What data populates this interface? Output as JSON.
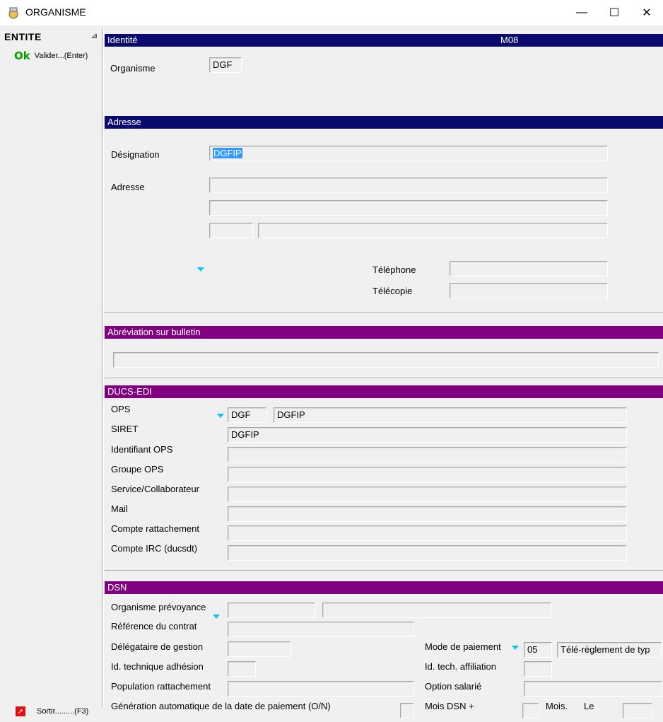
{
  "window": {
    "title": "ORGANISME",
    "minimize": "—",
    "maximize": "☐",
    "close": "✕"
  },
  "sidebar": {
    "entite": "ENTITE",
    "ok_icon": "Ok",
    "ok_label": "Valider...(Enter)",
    "sortir_label": "Sortir.........(F3)"
  },
  "identite": {
    "header": "Identité",
    "code": "M08",
    "organisme_label": "Organisme",
    "organisme_value": "DGF"
  },
  "adresse": {
    "header": "Adresse",
    "designation_label": "Désignation",
    "designation_value": "DGFIP",
    "adresse_label": "Adresse",
    "telephone_label": "Téléphone",
    "telecopie_label": "Télécopie"
  },
  "abreviation": {
    "header": "Abréviation sur bulletin"
  },
  "ducs": {
    "header": "DUCS-EDI",
    "ops_label": "OPS",
    "ops_code": "DGF",
    "ops_name": "DGFIP",
    "siret_label": "SIRET",
    "siret_value": "DGFIP",
    "identifiant_label": "Identifiant OPS",
    "groupe_label": "Groupe OPS",
    "service_label": "Service/Collaborateur",
    "mail_label": "Mail",
    "compte_label": "Compte rattachement",
    "compte_irc_label": "Compte IRC (ducsdt)"
  },
  "dsn": {
    "header": "DSN",
    "prevoyance_label": "Organisme prévoyance",
    "reference_label": "Référence du contrat",
    "delegataire_label": "Délégataire de gestion",
    "id_adhesion_label": "Id. technique adhésion",
    "population_label": "Population rattachement",
    "generation_label": "Génération automatique de la date de paiement (O/N)",
    "mode_label": "Mode de paiement",
    "mode_code": "05",
    "mode_value": "Télé-règlement de typ",
    "id_affiliation_label": "Id. tech. affiliation",
    "option_label": "Option salarié",
    "mois_dsn_label": "Mois DSN +",
    "mois_label": "Mois.",
    "le_label": "Le"
  }
}
